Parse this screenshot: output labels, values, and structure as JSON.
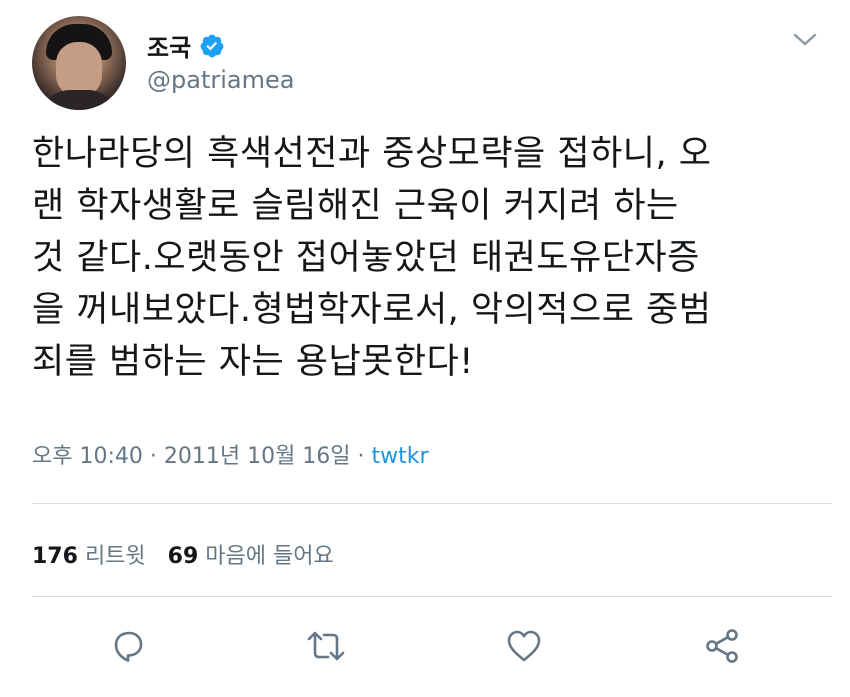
{
  "author": {
    "display_name": "조국",
    "handle": "@patriamea",
    "verified": true,
    "avatar_icon": "profile-photo"
  },
  "tweet": {
    "lines": [
      "한나라당의 흑색선전과 중상모략을 접하니, 오",
      "랜 학자생활로 슬림해진 근육이 커지려 하는",
      "것 같다.오랫동안 접어놓았던 태권도유단자증",
      "을 꺼내보았다.형법학자로서, 악의적으로 중범",
      "죄를 범하는 자는 용납못한다!"
    ],
    "timestamp": "오후 10:40 · 2011년 10월 16일 · ",
    "source": "twtkr"
  },
  "stats": {
    "retweets_count": "176",
    "retweets_label": "리트윗",
    "likes_count": "69",
    "likes_label": "마음에 들어요"
  },
  "actions": [
    "reply-icon",
    "retweet-icon",
    "like-icon",
    "share-icon"
  ],
  "colors": {
    "verified_blue": "#1da1f2",
    "link_blue": "#1b95e0",
    "secondary_text": "#657786",
    "icon_gray": "#657786"
  }
}
